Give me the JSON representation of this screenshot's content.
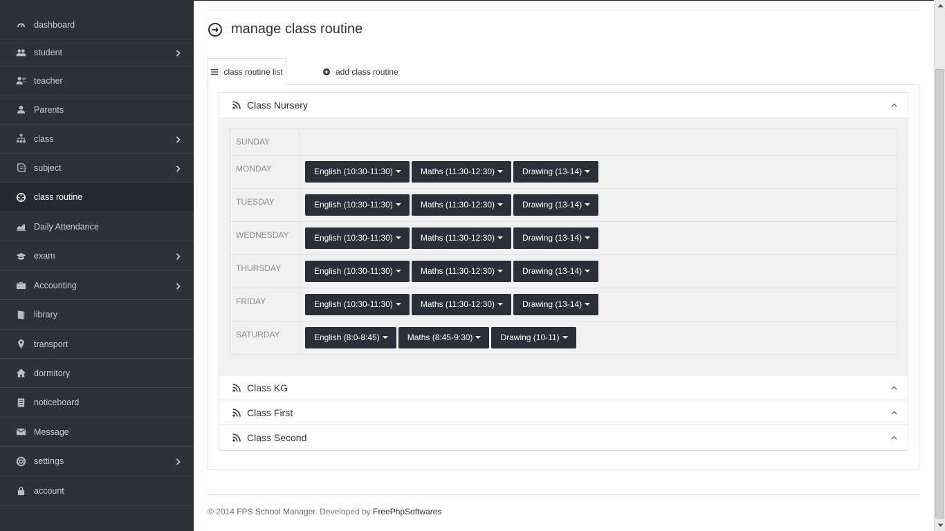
{
  "sidebar": {
    "items": [
      {
        "label": "dashboard",
        "icon": "dashboard-icon",
        "chevron": false,
        "active": false
      },
      {
        "label": "student",
        "icon": "users-icon",
        "chevron": true,
        "active": false
      },
      {
        "label": "teacher",
        "icon": "teacher-icon",
        "chevron": false,
        "active": false
      },
      {
        "label": "Parents",
        "icon": "user-icon",
        "chevron": false,
        "active": false
      },
      {
        "label": "class",
        "icon": "sitemap-icon",
        "chevron": true,
        "active": false
      },
      {
        "label": "subject",
        "icon": "book-icon",
        "chevron": true,
        "active": false
      },
      {
        "label": "class routine",
        "icon": "crosshair-icon",
        "chevron": false,
        "active": true
      },
      {
        "label": "Daily Attendance",
        "icon": "chart-icon",
        "chevron": false,
        "active": false
      },
      {
        "label": "exam",
        "icon": "graduation-icon",
        "chevron": true,
        "active": false
      },
      {
        "label": "Accounting",
        "icon": "briefcase-icon",
        "chevron": true,
        "active": false
      },
      {
        "label": "library",
        "icon": "library-book-icon",
        "chevron": false,
        "active": false
      },
      {
        "label": "transport",
        "icon": "map-pin-icon",
        "chevron": false,
        "active": false
      },
      {
        "label": "dormitory",
        "icon": "home-icon",
        "chevron": false,
        "active": false
      },
      {
        "label": "noticeboard",
        "icon": "notice-icon",
        "chevron": false,
        "active": false
      },
      {
        "label": "Message",
        "icon": "mail-icon",
        "chevron": false,
        "active": false
      },
      {
        "label": "settings",
        "icon": "lifebuoy-icon",
        "chevron": true,
        "active": false
      },
      {
        "label": "account",
        "icon": "lock-icon",
        "chevron": false,
        "active": false
      }
    ]
  },
  "page": {
    "title": "manage class routine",
    "tabs": {
      "list_label": "class routine list",
      "add_label": "add class routine"
    }
  },
  "classes": [
    {
      "name": "Class Nursery",
      "expanded": true
    },
    {
      "name": "Class KG",
      "expanded": false
    },
    {
      "name": "Class First",
      "expanded": false
    },
    {
      "name": "Class Second",
      "expanded": false
    }
  ],
  "routine": [
    {
      "day": "SUNDAY",
      "slots": []
    },
    {
      "day": "MONDAY",
      "slots": [
        "English (10:30-11:30)",
        "Maths (11:30-12:30)",
        "Drawing (13-14)"
      ]
    },
    {
      "day": "TUESDAY",
      "slots": [
        "English (10:30-11:30)",
        "Maths (11:30-12:30)",
        "Drawing (13-14)"
      ]
    },
    {
      "day": "WEDNESDAY",
      "slots": [
        "English (10:30-11:30)",
        "Maths (11:30-12:30)",
        "Drawing (13-14)"
      ]
    },
    {
      "day": "THURSDAY",
      "slots": [
        "English (10:30-11:30)",
        "Maths (11:30-12:30)",
        "Drawing (13-14)"
      ]
    },
    {
      "day": "FRIDAY",
      "slots": [
        "English (10:30-11:30)",
        "Maths (11:30-12:30)",
        "Drawing (13-14)"
      ]
    },
    {
      "day": "SATURDAY",
      "slots": [
        "English (8:0-8:45)",
        "Maths (8:45-9:30)",
        "Drawing (10-11)"
      ]
    }
  ],
  "footer": {
    "copyright": "© 2014",
    "brand": "FPS School Manager",
    "developed_by": ". Developed by",
    "developer": "FreePhpSoftwares"
  },
  "colors": {
    "sidebar_bg": "#2e3238",
    "sidebar_active_bg": "#262a2f",
    "button_bg": "#2a303a",
    "accordion_body_bg": "#f1f1f1"
  }
}
